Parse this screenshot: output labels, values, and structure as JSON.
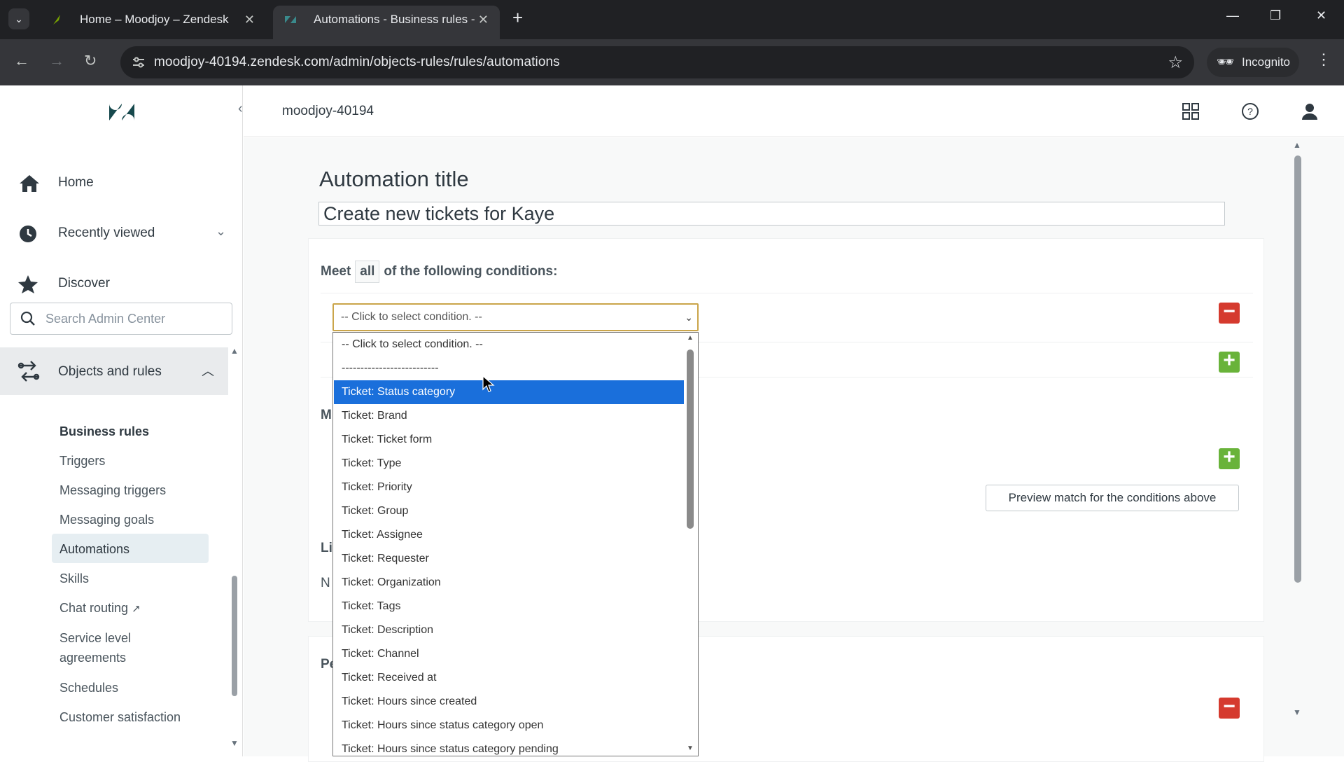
{
  "browser": {
    "tabs": [
      {
        "title": "Home – Moodjoy – Zendesk"
      },
      {
        "title": "Automations - Business rules -"
      }
    ],
    "url": "moodjoy-40194.zendesk.com/admin/objects-rules/rules/automations",
    "incognito_label": "Incognito"
  },
  "sidebar": {
    "nav": [
      {
        "label": "Home"
      },
      {
        "label": "Recently viewed"
      },
      {
        "label": "Discover"
      }
    ],
    "search_placeholder": "Search Admin Center",
    "section": "Objects and rules",
    "sub_heading": "Business rules",
    "sub_items": [
      {
        "label": "Triggers"
      },
      {
        "label": "Messaging triggers"
      },
      {
        "label": "Messaging goals"
      },
      {
        "label": "Automations"
      },
      {
        "label": "Skills"
      },
      {
        "label": "Chat routing"
      },
      {
        "label": "Service level"
      },
      {
        "label": "agreements"
      },
      {
        "label": "Schedules"
      },
      {
        "label": "Customer satisfaction"
      }
    ]
  },
  "header": {
    "account": "moodjoy-40194"
  },
  "form": {
    "title_label": "Automation title",
    "title_value": "Create new tickets for Kaye",
    "meet_prefix": "Meet",
    "meet_value": "all",
    "meet_suffix": "of the following conditions:",
    "condition_select_value": "-- Click to select condition. --",
    "preview_button": "Preview match for the conditions above",
    "partial_letters": [
      "M",
      "Li",
      "N",
      "Pe"
    ]
  },
  "dropdown": {
    "options": [
      "-- Click to select condition. --",
      "--------------------------",
      "Ticket: Status category",
      "Ticket: Brand",
      "Ticket: Ticket form",
      "Ticket: Type",
      "Ticket: Priority",
      "Ticket: Group",
      "Ticket: Assignee",
      "Ticket: Requester",
      "Ticket: Organization",
      "Ticket: Tags",
      "Ticket: Description",
      "Ticket: Channel",
      "Ticket: Received at",
      "Ticket: Hours since created",
      "Ticket: Hours since status category open",
      "Ticket: Hours since status category pending"
    ],
    "selected": "Ticket: Status category"
  },
  "colors": {
    "selected_option": "#1a6fdb",
    "remove_button": "#d53a2e",
    "add_button": "#69b33a"
  }
}
